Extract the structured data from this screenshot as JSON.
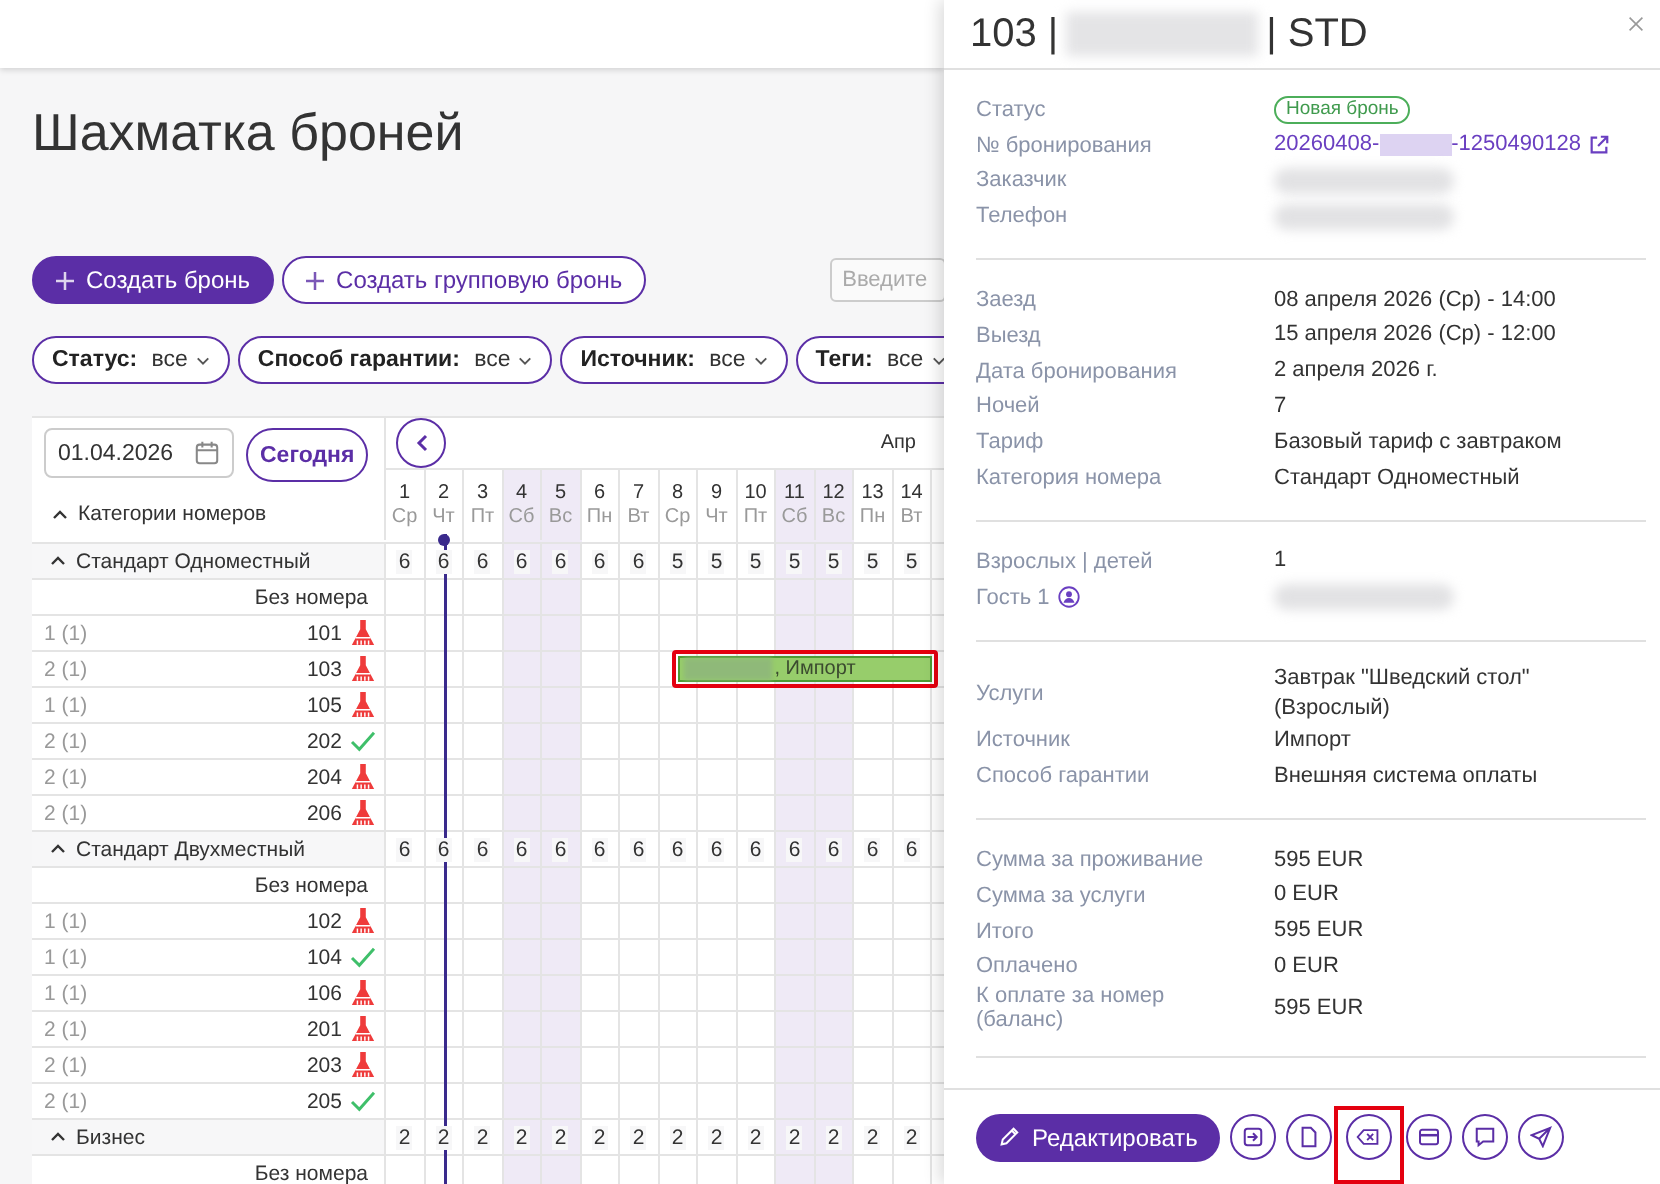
{
  "page_title": "Шахматка броней",
  "actions": [
    {
      "label": "Создать бронь",
      "kind": "primary"
    },
    {
      "label": "Создать групповую бронь",
      "kind": "outline"
    }
  ],
  "search": {
    "placeholder": "Введите"
  },
  "filters": [
    {
      "label": "Статус:",
      "value": "все"
    },
    {
      "label": "Способ гарантии:",
      "value": "все"
    },
    {
      "label": "Источник:",
      "value": "все"
    },
    {
      "label": "Теги:",
      "value": "все"
    }
  ],
  "date_field": {
    "value": "01.04.2026"
  },
  "today_button": "Сегодня",
  "month_label": "Апр",
  "categories_header": "Категории номеров",
  "days": [
    {
      "day": "1",
      "weekday": "Ср",
      "weekend": false,
      "today": false
    },
    {
      "day": "2",
      "weekday": "Чт",
      "weekend": false,
      "today": true
    },
    {
      "day": "3",
      "weekday": "Пт",
      "weekend": false,
      "today": false
    },
    {
      "day": "4",
      "weekday": "Сб",
      "weekend": true,
      "today": false
    },
    {
      "day": "5",
      "weekday": "Вс",
      "weekend": true,
      "today": false
    },
    {
      "day": "6",
      "weekday": "Пн",
      "weekend": false,
      "today": false
    },
    {
      "day": "7",
      "weekday": "Вт",
      "weekend": false,
      "today": false
    },
    {
      "day": "8",
      "weekday": "Ср",
      "weekend": false,
      "today": false
    },
    {
      "day": "9",
      "weekday": "Чт",
      "weekend": false,
      "today": false
    },
    {
      "day": "10",
      "weekday": "Пт",
      "weekend": false,
      "today": false
    },
    {
      "day": "11",
      "weekday": "Сб",
      "weekend": true,
      "today": false
    },
    {
      "day": "12",
      "weekday": "Вс",
      "weekend": true,
      "today": false
    },
    {
      "day": "13",
      "weekday": "Пн",
      "weekend": false,
      "today": false
    },
    {
      "day": "14",
      "weekday": "Вт",
      "weekend": false,
      "today": false
    }
  ],
  "groups": [
    {
      "name": "Стандарт Одноместный",
      "expanded": true,
      "availability": [
        "6",
        "6",
        "6",
        "6",
        "6",
        "6",
        "6",
        "5",
        "5",
        "5",
        "5",
        "5",
        "5",
        "5"
      ],
      "rows": [
        {
          "kind": "unassigned",
          "label": "Без номера"
        },
        {
          "kind": "room",
          "occupancy": "1 (1)",
          "number": "101",
          "clean": false
        },
        {
          "kind": "room",
          "occupancy": "2 (1)",
          "number": "103",
          "clean": false,
          "booking": {
            "cells": [
              {
                "kind": "free"
              },
              {
                "kind": "free"
              },
              {
                "kind": "free"
              },
              {
                "kind": "free"
              },
              {
                "kind": "free"
              },
              {
                "kind": "free"
              },
              {
                "kind": "free"
              },
              {
                "kind": "arrival"
              },
              {
                "kind": "stay"
              },
              {
                "kind": "stay"
              },
              {
                "kind": "stay"
              },
              {
                "kind": "stay"
              },
              {
                "kind": "stay"
              },
              {
                "kind": "stay"
              }
            ],
            "label": ", Импорт",
            "highlighted": true
          }
        },
        {
          "kind": "room",
          "occupancy": "1 (1)",
          "number": "105",
          "clean": false
        },
        {
          "kind": "room",
          "occupancy": "2 (1)",
          "number": "202",
          "clean": true
        },
        {
          "kind": "room",
          "occupancy": "2 (1)",
          "number": "204",
          "clean": false
        },
        {
          "kind": "room",
          "occupancy": "2 (1)",
          "number": "206",
          "clean": false
        }
      ]
    },
    {
      "name": "Стандарт Двухместный",
      "expanded": true,
      "availability": [
        "6",
        "6",
        "6",
        "6",
        "6",
        "6",
        "6",
        "6",
        "6",
        "6",
        "6",
        "6",
        "6",
        "6"
      ],
      "rows": [
        {
          "kind": "unassigned",
          "label": "Без номера"
        },
        {
          "kind": "room",
          "occupancy": "1 (1)",
          "number": "102",
          "clean": false
        },
        {
          "kind": "room",
          "occupancy": "1 (1)",
          "number": "104",
          "clean": true
        },
        {
          "kind": "room",
          "occupancy": "1 (1)",
          "number": "106",
          "clean": false
        },
        {
          "kind": "room",
          "occupancy": "2 (1)",
          "number": "201",
          "clean": false
        },
        {
          "kind": "room",
          "occupancy": "2 (1)",
          "number": "203",
          "clean": false
        },
        {
          "kind": "room",
          "occupancy": "2 (1)",
          "number": "205",
          "clean": true
        }
      ]
    },
    {
      "name": "Бизнес",
      "expanded": true,
      "availability": [
        "2",
        "2",
        "2",
        "2",
        "2",
        "2",
        "2",
        "2",
        "2",
        "2",
        "2",
        "2",
        "2",
        "2"
      ],
      "rows": [
        {
          "kind": "unassigned",
          "label": "Без номера"
        }
      ]
    }
  ],
  "details": {
    "title_start": "103 |",
    "title_end": "| STD",
    "sections": [
      [
        {
          "label": "Статус",
          "kind": "badge",
          "value": "Новая бронь"
        },
        {
          "label": "№ бронирования",
          "kind": "link",
          "value_start": "20260408-",
          "value_end": "-1250490128"
        },
        {
          "label": "Заказчик",
          "kind": "hidden"
        },
        {
          "label": "Телефон",
          "kind": "hidden"
        }
      ],
      [
        {
          "label": "Заезд",
          "kind": "text",
          "value": "08 апреля 2026 (Ср) - 14:00"
        },
        {
          "label": "Выезд",
          "kind": "text",
          "value": "15 апреля 2026 (Ср) - 12:00"
        },
        {
          "label": "Дата бронирования",
          "kind": "text",
          "value": "2 апреля 2026 г."
        },
        {
          "label": "Ночей",
          "kind": "text",
          "value": "7"
        },
        {
          "label": "Тариф",
          "kind": "text",
          "value": "Базовый тариф с завтраком"
        },
        {
          "label": "Категория номера",
          "kind": "text",
          "value": "Стандарт Одноместный"
        }
      ],
      [
        {
          "label": "Взрослых | детей",
          "kind": "text",
          "value": "1"
        },
        {
          "label": "Гость 1",
          "kind": "guest"
        }
      ],
      [
        {
          "label": "Услуги",
          "kind": "lines",
          "lines": [
            "Завтрак \"Шведский стол\"",
            "(Взрослый)"
          ]
        },
        {
          "label": "Источник",
          "kind": "text",
          "value": "Импорт"
        },
        {
          "label": "Способ гарантии",
          "kind": "text",
          "value": "Внешняя система оплаты"
        }
      ],
      [
        {
          "label": "Сумма за проживание",
          "kind": "text",
          "value": "595 EUR"
        },
        {
          "label": "Сумма за услуги",
          "kind": "text",
          "value": "0 EUR"
        },
        {
          "label": "Итого",
          "kind": "text",
          "value": "595 EUR"
        },
        {
          "label": "Оплачено",
          "kind": "text",
          "value": "0 EUR"
        },
        {
          "label": "К оплате за номер (баланс)",
          "kind": "text",
          "value": "595 EUR"
        }
      ]
    ],
    "edit_button": "Редактировать",
    "icon_buttons": [
      {
        "kind": "check-in",
        "highlighted": false
      },
      {
        "kind": "document",
        "highlighted": false
      },
      {
        "kind": "cancel",
        "highlighted": true
      },
      {
        "kind": "card",
        "highlighted": false
      },
      {
        "kind": "comment",
        "highlighted": false
      },
      {
        "kind": "send",
        "highlighted": false
      }
    ]
  }
}
